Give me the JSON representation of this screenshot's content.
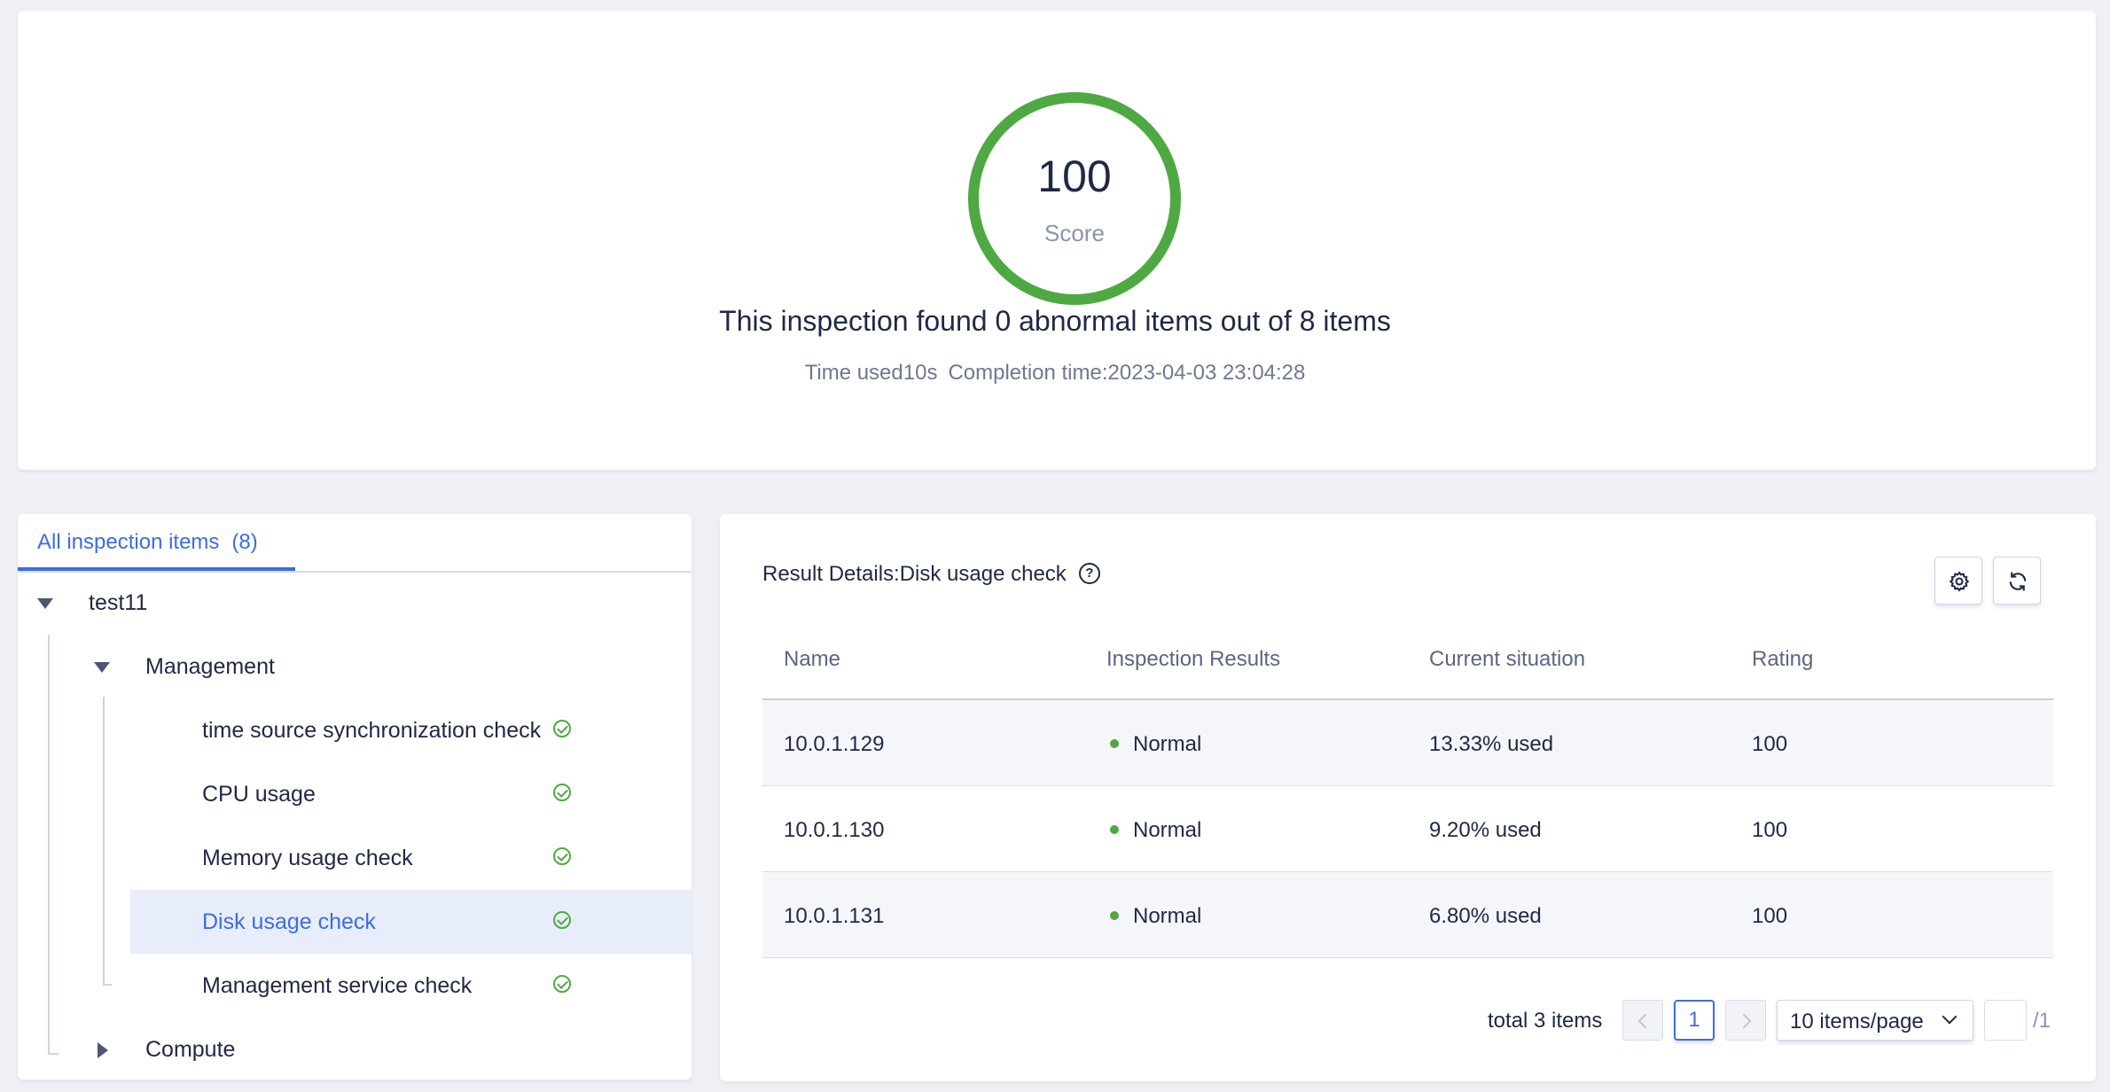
{
  "score": {
    "value": "100",
    "label": "Score",
    "summary": "This inspection found 0 abnormal items out of 8 items",
    "time_used": "Time used10s",
    "completion_time": "Completion time:2023-04-03 23:04:28",
    "ring_color": "#4fa942"
  },
  "tree": {
    "tab_label": "All inspection items",
    "tab_count": "(8)",
    "root": "test11",
    "group_management": "Management",
    "items": [
      {
        "label": "time source synchronization check",
        "status": "ok"
      },
      {
        "label": "CPU usage",
        "status": "ok"
      },
      {
        "label": "Memory usage check",
        "status": "ok"
      },
      {
        "label": "Disk usage check",
        "status": "ok",
        "selected": true
      },
      {
        "label": "Management service check",
        "status": "ok"
      }
    ],
    "group_compute": "Compute"
  },
  "details": {
    "title": "Result Details:Disk usage check",
    "help_glyph": "?",
    "columns": [
      "Name",
      "Inspection Results",
      "Current situation",
      "Rating"
    ],
    "rows": [
      {
        "name": "10.0.1.129",
        "result": "Normal",
        "situation": "13.33% used",
        "rating": "100"
      },
      {
        "name": "10.0.1.130",
        "result": "Normal",
        "situation": "9.20% used",
        "rating": "100"
      },
      {
        "name": "10.0.1.131",
        "result": "Normal",
        "situation": "6.80% used",
        "rating": "100"
      }
    ],
    "status_color": "#4fa942"
  },
  "pagination": {
    "total": "total 3 items",
    "current_page": "1",
    "page_size": "10 items/page",
    "jump_value": "",
    "total_pages": "/1"
  },
  "colors": {
    "accent": "#3c6ce6",
    "success": "#4fa942",
    "background": "#eef0f6"
  }
}
